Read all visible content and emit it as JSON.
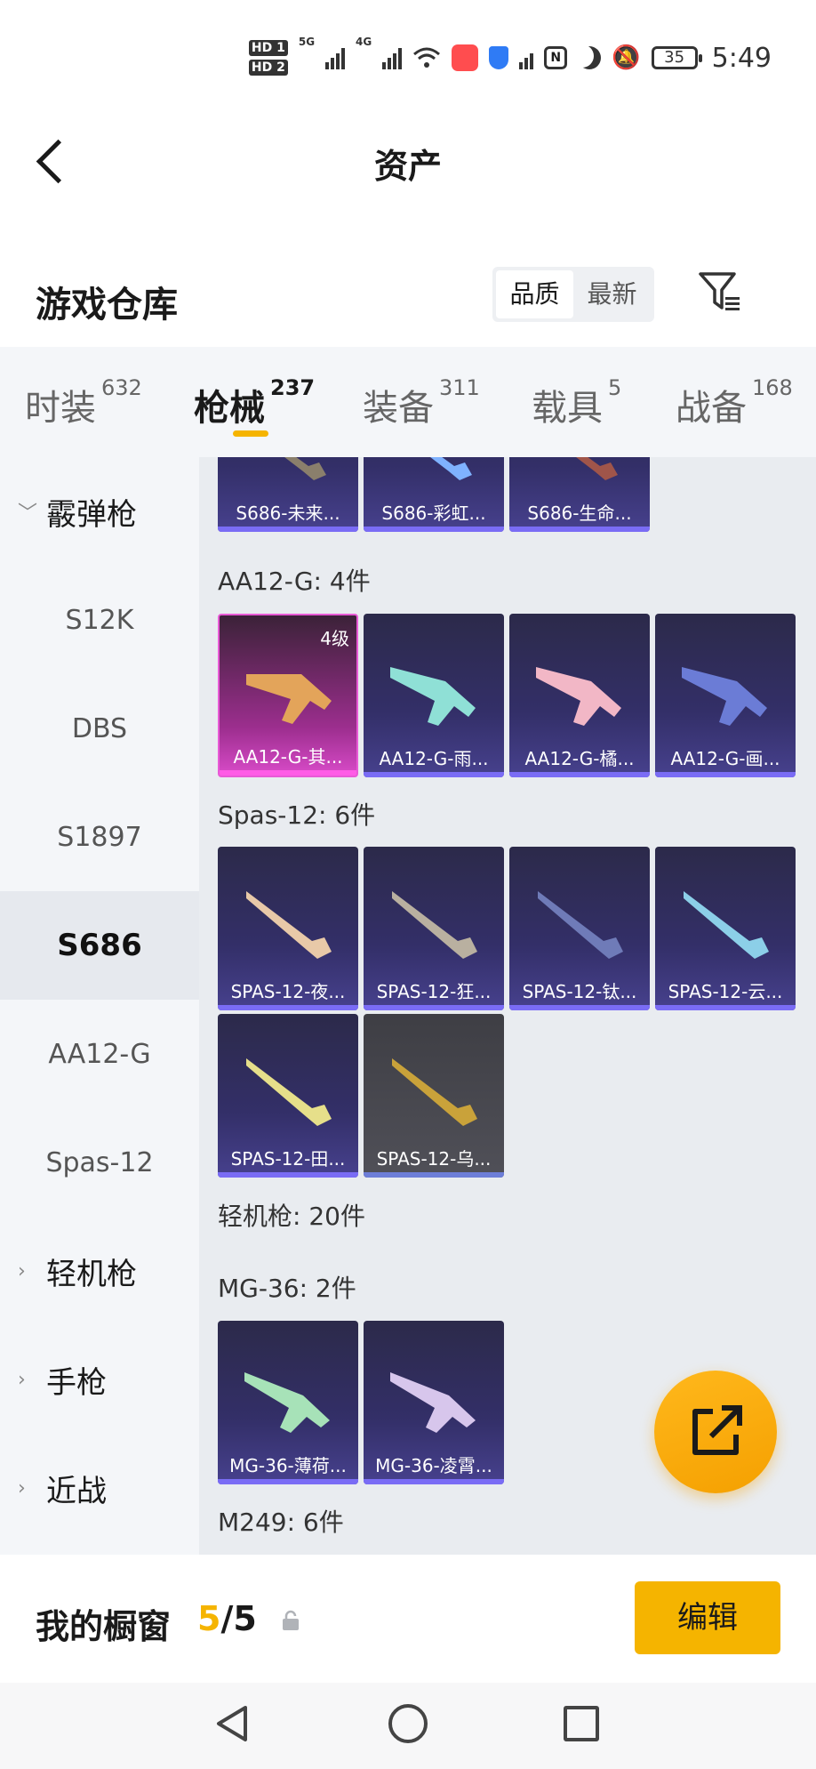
{
  "status_bar": {
    "hd1": "HD 1",
    "hd2": "HD 2",
    "net1": "5G",
    "net2": "4G",
    "battery": "35",
    "time": "5:49"
  },
  "header": {
    "title": "资产"
  },
  "section": {
    "title": "游戏仓库",
    "sort_options": [
      "品质",
      "最新"
    ],
    "active_sort": "品质"
  },
  "category_tabs": [
    {
      "label": "时装",
      "count": "632"
    },
    {
      "label": "枪械",
      "count": "237",
      "active": true
    },
    {
      "label": "装备",
      "count": "311"
    },
    {
      "label": "载具",
      "count": "5"
    },
    {
      "label": "战备",
      "count": "168"
    }
  ],
  "sidebar": {
    "items": [
      {
        "label": "霰弹枪",
        "type": "group",
        "expanded": true
      },
      {
        "label": "S12K"
      },
      {
        "label": "DBS"
      },
      {
        "label": "S1897"
      },
      {
        "label": "S686",
        "selected": true
      },
      {
        "label": "AA12-G"
      },
      {
        "label": "Spas-12"
      },
      {
        "label": "轻机枪",
        "type": "group"
      },
      {
        "label": "手枪",
        "type": "group"
      },
      {
        "label": "近战",
        "type": "group"
      }
    ]
  },
  "content": {
    "s686_cards": [
      "S686-未来...",
      "S686-彩虹...",
      "S686-生命..."
    ],
    "aa12_header": "AA12-G: 4件",
    "aa12_cards": [
      {
        "name": "AA12-G-其...",
        "tier": "4级"
      },
      {
        "name": "AA12-G-雨..."
      },
      {
        "name": "AA12-G-橘..."
      },
      {
        "name": "AA12-G-画..."
      }
    ],
    "spas_header": "Spas-12: 6件",
    "spas_cards": [
      "SPAS-12-夜...",
      "SPAS-12-狂...",
      "SPAS-12-钛...",
      "SPAS-12-云...",
      "SPAS-12-田...",
      "SPAS-12-乌..."
    ],
    "lmg_header": "轻机枪: 20件",
    "mg36_header": "MG-36: 2件",
    "mg36_cards": [
      "MG-36-薄荷...",
      "MG-36-凌霄..."
    ],
    "m249_header": "M249: 6件"
  },
  "showcase": {
    "label": "我的橱窗",
    "current": "5",
    "total": "/5",
    "edit_label": "编辑"
  },
  "colors": {
    "accent": "#f5b400",
    "card_purple": "#332f68",
    "card_gold": "#9c2e8e"
  }
}
